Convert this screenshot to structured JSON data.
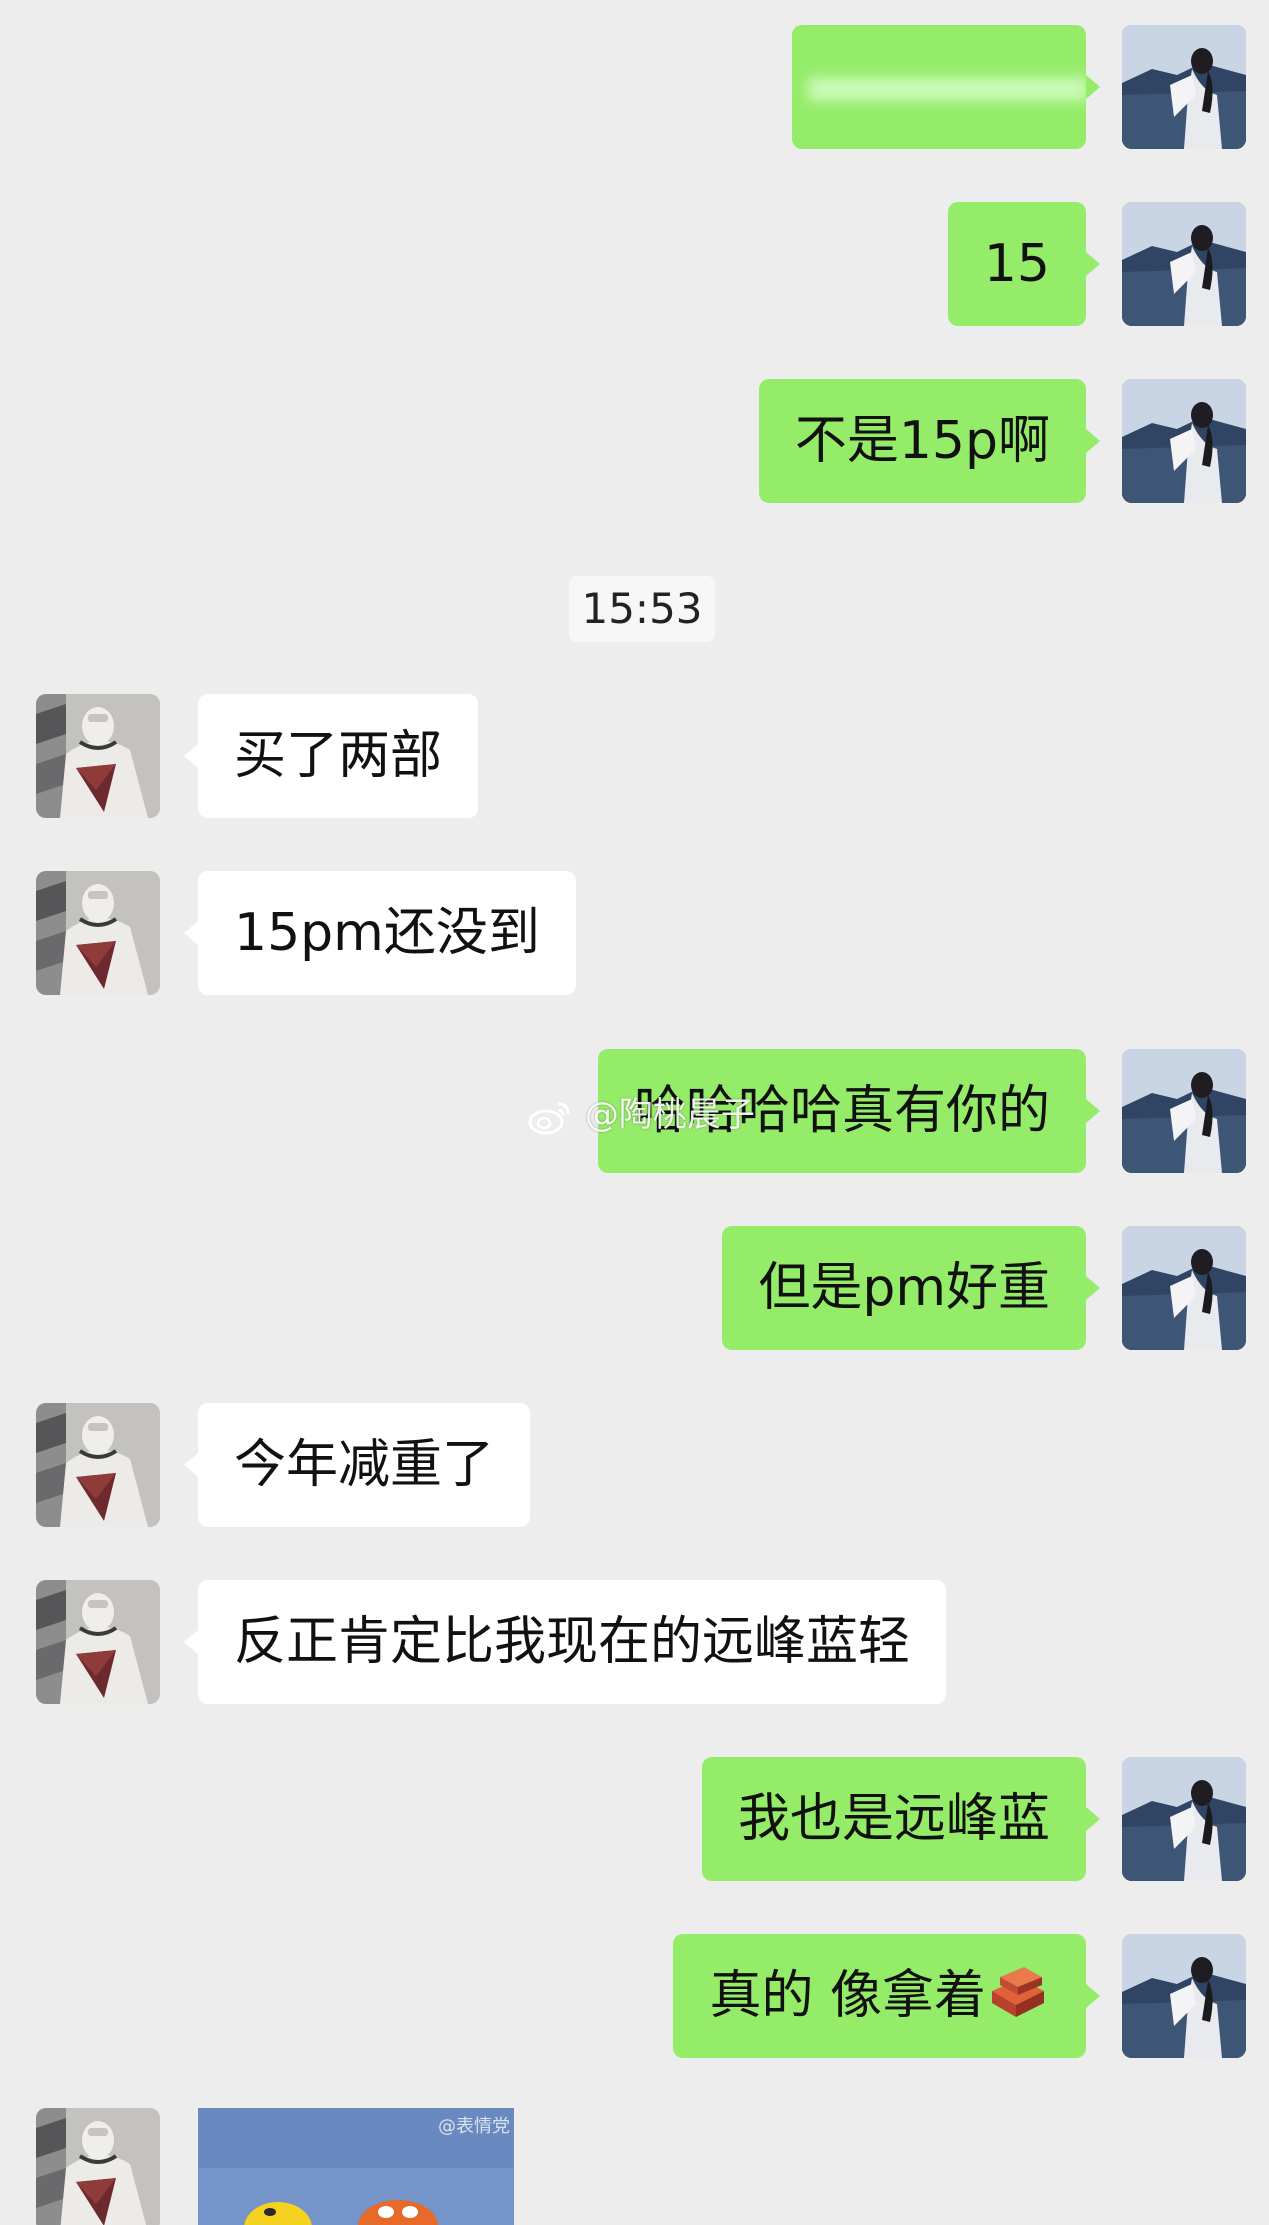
{
  "messages": [
    {
      "id": "m1",
      "side": "out",
      "text": "",
      "blurred": true
    },
    {
      "id": "m2",
      "side": "out",
      "text": "15"
    },
    {
      "id": "m3",
      "side": "out",
      "text": "不是15p啊"
    },
    {
      "id": "m4",
      "side": "in",
      "text": "买了两部"
    },
    {
      "id": "m5",
      "side": "in",
      "text": "15pm还没到"
    },
    {
      "id": "m6",
      "side": "out",
      "text": "哈哈哈哈真有你的"
    },
    {
      "id": "m7",
      "side": "out",
      "text": "但是pm好重"
    },
    {
      "id": "m8",
      "side": "in",
      "text": "今年减重了"
    },
    {
      "id": "m9",
      "side": "in",
      "text": "反正肯定比我现在的远峰蓝轻"
    },
    {
      "id": "m10",
      "side": "out",
      "text": "我也是远峰蓝"
    },
    {
      "id": "m11",
      "side": "out",
      "text": "真的 像拿着",
      "emoji": "brick-icon"
    }
  ],
  "timestamp": "15:53",
  "watermark": "@陶桃晨子",
  "sticker": {
    "type": "image",
    "watermark_text": "@表情党"
  },
  "colors": {
    "background": "#ededed",
    "outgoing_bubble": "#95ec69",
    "incoming_bubble": "#ffffff"
  },
  "icons": {
    "outgoing_avatar": "avatar-woman-seaside-icon",
    "incoming_avatar": "avatar-figure-icon",
    "watermark": "weibo-icon"
  }
}
